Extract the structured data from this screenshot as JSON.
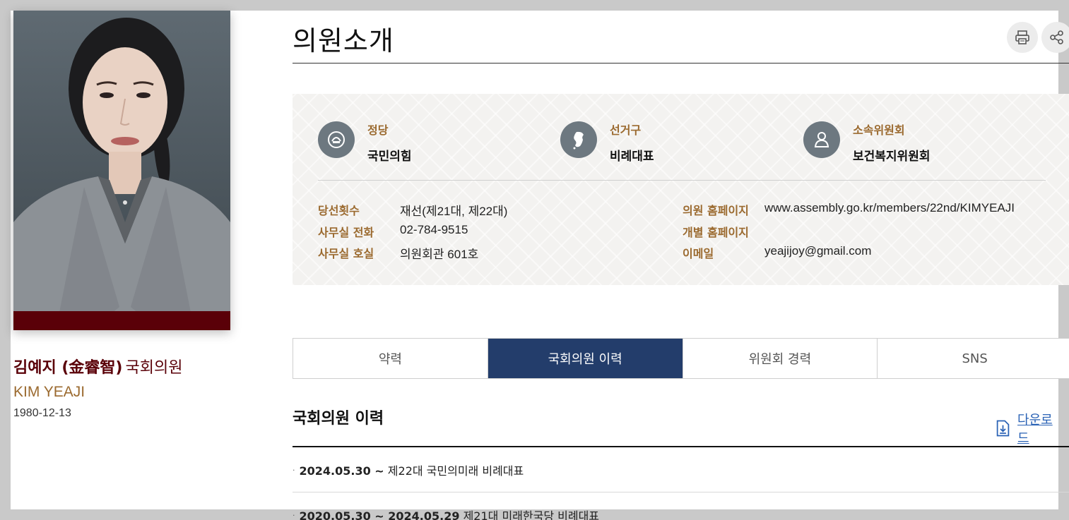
{
  "profile": {
    "name_ko": "김예지 (金睿智)",
    "title": "국회의원",
    "name_en": "KIM YEAJI",
    "birth": "1980-12-13"
  },
  "header": {
    "title": "의원소개"
  },
  "info": {
    "party_label": "정당",
    "party_value": "국민의힘",
    "district_label": "선거구",
    "district_value": "비례대표",
    "committee_label": "소속위원회",
    "committee_value": "보건복지위원회"
  },
  "details": {
    "terms_label": "당선횟수",
    "terms_value": "재선(제21대, 제22대)",
    "phone_label": "사무실 전화",
    "phone_value": "02-784-9515",
    "room_label": "사무실 호실",
    "room_value": "의원회관 601호",
    "homepage_label": "의원 홈페이지",
    "homepage_value": "www.assembly.go.kr/members/22nd/KIMYEAJI",
    "personal_label": "개별 홈페이지",
    "personal_value": "",
    "email_label": "이메일",
    "email_value": "yeajijoy@gmail.com"
  },
  "tabs": [
    "약력",
    "국회의원 이력",
    "위원회 경력",
    "SNS"
  ],
  "active_tab": "국회의원 이력",
  "history": {
    "title": "국회의원 이력",
    "download_label": "다운로드",
    "items": [
      {
        "period": "2024.05.30 ~",
        "desc": "제22대 국민의미래 비례대표"
      },
      {
        "period": "2020.05.30 ~ 2024.05.29",
        "desc": "제21대 미래한국당 비례대표"
      }
    ]
  },
  "colors": {
    "accent_navy": "#233d6b",
    "label_brown": "#9b6a2f",
    "name_maroon": "#5a0008"
  }
}
